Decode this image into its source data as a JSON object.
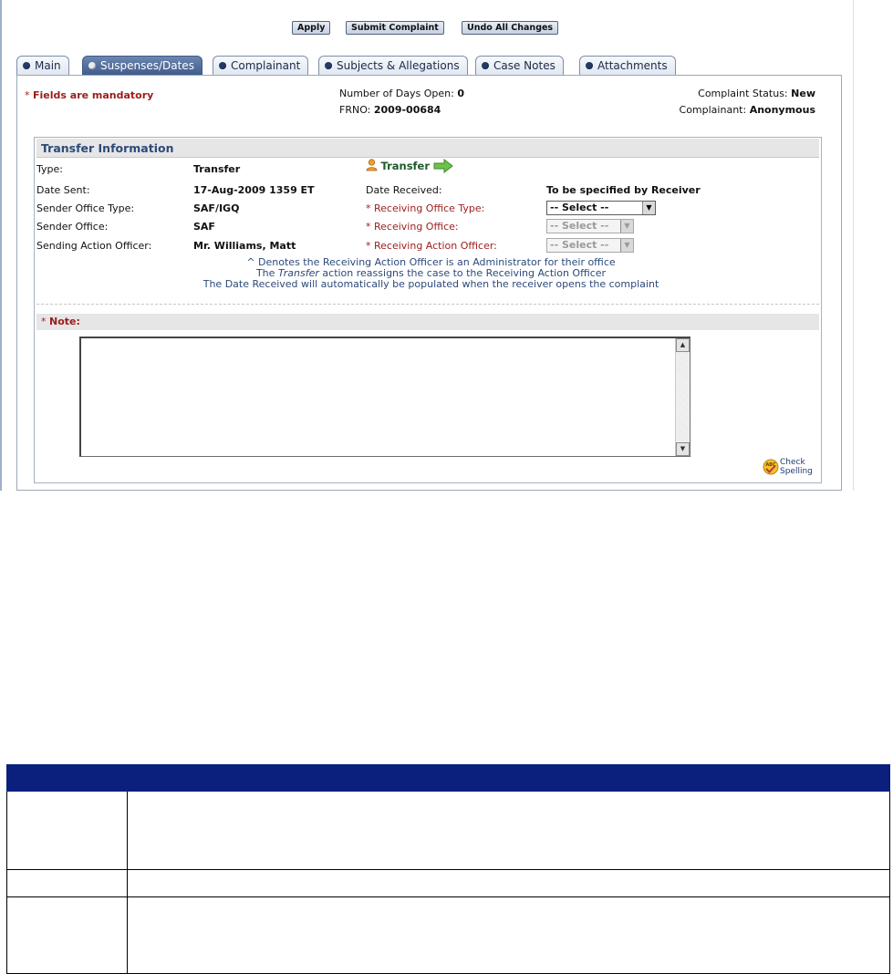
{
  "toolbar": {
    "apply_label": "Apply",
    "submit_label": "Submit Complaint",
    "undo_label": "Undo All Changes"
  },
  "tabs": [
    {
      "label": "Main",
      "active": false
    },
    {
      "label": "Suspenses/Dates",
      "active": true
    },
    {
      "label": "Complainant",
      "active": false
    },
    {
      "label": "Subjects & Allegations",
      "active": false
    },
    {
      "label": "Case Notes",
      "active": false
    },
    {
      "label": "Attachments",
      "active": false
    }
  ],
  "header": {
    "mandatory_asterisk": "*",
    "mandatory_text": "Fields are mandatory",
    "days_open_label": "Number of Days Open:",
    "days_open_value": "0",
    "frno_label": "FRNO:",
    "frno_value": "2009-00684",
    "status_label": "Complaint Status:",
    "status_value": "New",
    "complainant_label": "Complainant:",
    "complainant_value": "Anonymous"
  },
  "transfer": {
    "section_title": "Transfer Information",
    "type_label": "Type:",
    "type_value": "Transfer",
    "action_link": "Transfer",
    "date_sent_label": "Date Sent:",
    "date_sent_value": "17-Aug-2009 1359 ET",
    "date_received_label": "Date Received:",
    "date_received_value": "To be specified by Receiver",
    "sender_office_type_label": "Sender Office Type:",
    "sender_office_type_value": "SAF/IGQ",
    "receiving_office_type_label": "* Receiving Office Type:",
    "receiving_office_type_select": "-- Select --",
    "sender_office_label": "Sender Office:",
    "sender_office_value": "SAF",
    "receiving_office_label": "* Receiving Office:",
    "receiving_office_select": "-- Select --",
    "sending_officer_label": "Sending Action Officer:",
    "sending_officer_value": "Mr. Williams, Matt",
    "receiving_officer_label": "* Receiving Action Officer:",
    "receiving_officer_select": "-- Select --",
    "note_line1": "^ Denotes the Receiving Action Officer is an Administrator for their office",
    "note_line2_pre": "The ",
    "note_line2_em": "Transfer",
    "note_line2_post": " action reassigns the case to the Receiving Action Officer",
    "note_line3": "The Date Received will automatically be populated when the receiver opens the complaint"
  },
  "note": {
    "asterisk": "*",
    "label": "Note:",
    "value": "",
    "spell_check_line1": "Check",
    "spell_check_line2": "Spelling"
  },
  "colors": {
    "accent_blue": "#2c4a7a",
    "required_red": "#9b1c1c",
    "table_header": "#0b1f7d"
  }
}
